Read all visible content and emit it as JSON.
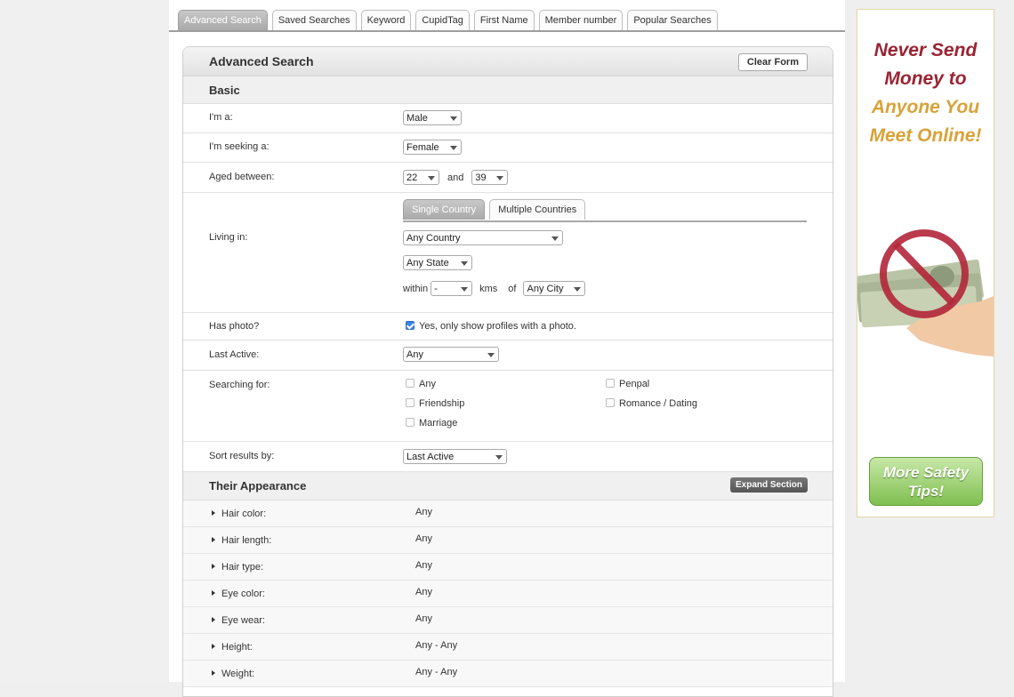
{
  "tabs": [
    "Advanced Search",
    "Saved Searches",
    "Keyword",
    "CupidTag",
    "First Name",
    "Member number",
    "Popular Searches"
  ],
  "panel": {
    "title": "Advanced Search",
    "clear_label": "Clear Form"
  },
  "basic": {
    "title": "Basic",
    "im_a_label": "I'm a:",
    "im_a_value": "Male",
    "seeking_label": "I'm seeking a:",
    "seeking_value": "Female",
    "aged_label": "Aged between:",
    "age_min": "22",
    "and_text": "and",
    "age_max": "39",
    "living_label": "Living in:",
    "country_tabs": [
      "Single Country",
      "Multiple Countries"
    ],
    "country_value": "Any Country",
    "state_value": "Any State",
    "within_text": "within",
    "distance_value": "-",
    "kms_text": "kms",
    "of_text": "of",
    "city_value": "Any City",
    "photo_label": "Has photo?",
    "photo_option": "Yes, only show profiles with a photo.",
    "active_label": "Last Active:",
    "active_value": "Any",
    "searching_label": "Searching for:",
    "searching_options": [
      "Any",
      "Friendship",
      "Marriage",
      "Penpal",
      "Romance / Dating"
    ],
    "sort_label": "Sort results by:",
    "sort_value": "Last Active"
  },
  "appearance": {
    "title": "Their Appearance",
    "expand_label": "Expand Section",
    "rows": [
      {
        "label": "Hair color:",
        "value": "Any"
      },
      {
        "label": "Hair length:",
        "value": "Any"
      },
      {
        "label": "Hair type:",
        "value": "Any"
      },
      {
        "label": "Eye color:",
        "value": "Any"
      },
      {
        "label": "Eye wear:",
        "value": "Any"
      },
      {
        "label": "Height:",
        "value": "Any - Any"
      },
      {
        "label": "Weight:",
        "value": "Any - Any"
      }
    ]
  },
  "ad": {
    "line1": "Never Send",
    "line2": "Money to",
    "line3": "Anyone You",
    "line4": "Meet Online!",
    "button_line1": "More Safety",
    "button_line2": "Tips!",
    "colors": {
      "dark_red": "#9a2432",
      "gold": "#d7a338",
      "green": "#7fbf4f"
    },
    "image_icon": "no-money-icon"
  }
}
